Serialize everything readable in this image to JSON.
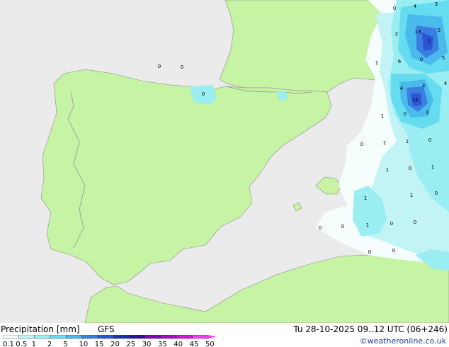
{
  "legend": {
    "title": "Precipitation [mm]",
    "model": "GFS",
    "scale_values": [
      "0.1",
      "0.5",
      "1",
      "2",
      "5",
      "10",
      "15",
      "20",
      "25",
      "30",
      "35",
      "40",
      "45",
      "50"
    ],
    "scale_colors": [
      "#f5fdfd",
      "#c2f4f6",
      "#9aeef2",
      "#66dcf0",
      "#4ab9eb",
      "#3a7fe0",
      "#2c55d4",
      "#1a2fb0",
      "#2c1496",
      "#7a0ab8",
      "#a40ac8",
      "#d414d8",
      "#ee40ee"
    ]
  },
  "run_info": "Tu 28-10-2025 09..12 UTC (06+246)",
  "credit": "©weatheronline.co.uk",
  "map": {
    "colors": {
      "sea": "#ebebeb",
      "land": "#c6f3a4",
      "border": "#8a8a8a"
    },
    "labels": [
      "0",
      "0",
      "0",
      "4",
      "3",
      "0",
      "2",
      "13",
      "5",
      "1",
      "6",
      "0",
      "5",
      "1",
      "4",
      "3",
      "4",
      "14",
      "0",
      "0",
      "1",
      "0",
      "1",
      "1",
      "0",
      "1",
      "0",
      "1",
      "1",
      "0",
      "1",
      "0",
      "1",
      "0",
      "0",
      "0",
      "0",
      "0"
    ]
  }
}
